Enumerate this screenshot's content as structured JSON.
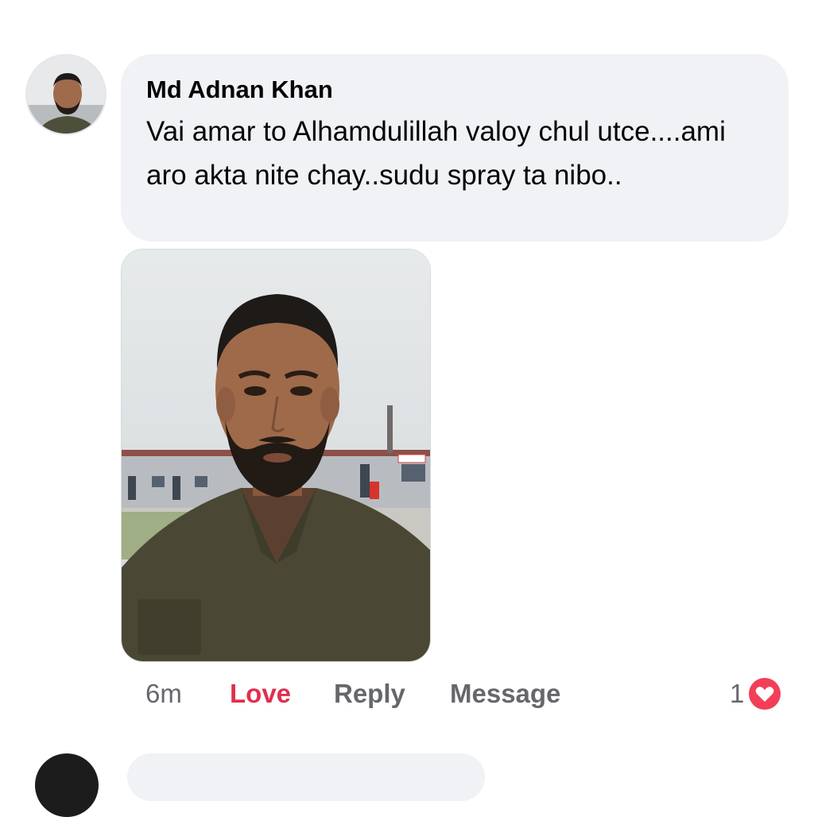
{
  "comment": {
    "author": "Md Adnan Khan",
    "text": "Vai amar to Alhamdulillah valoy chul utce....ami aro akta nite chay..sudu spray ta nibo..",
    "avatar_icon": "profile-photo",
    "photo_icon": "selfie-photo"
  },
  "actions": {
    "time": "6m",
    "love_label": "Love",
    "reply_label": "Reply",
    "message_label": "Message"
  },
  "reactions": {
    "count": "1",
    "icon": "heart-icon",
    "color": "#f33e58"
  },
  "colors": {
    "love_active": "#e02f4f",
    "bubble_bg": "#f0f2f5",
    "secondary_text": "#65676b"
  }
}
